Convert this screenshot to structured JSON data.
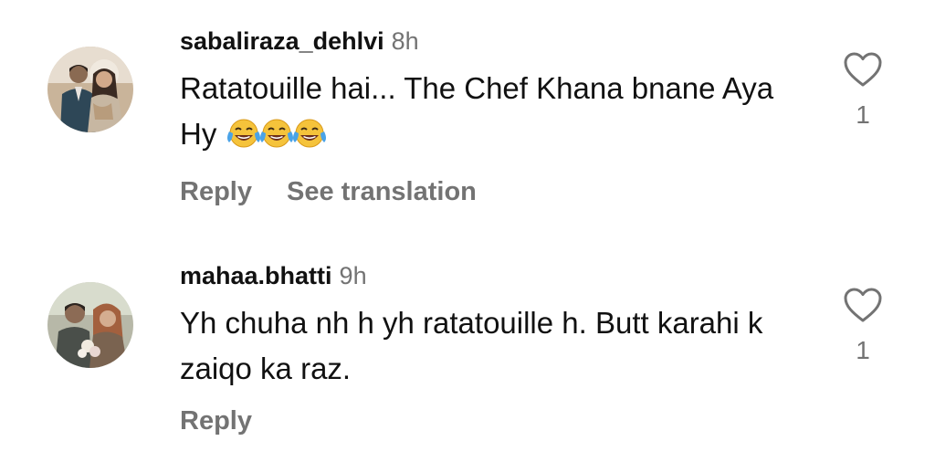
{
  "comments": [
    {
      "username": "sabaliraza_dehlvi",
      "time": "8h",
      "text": "Ratatouille hai... The Chef Khana bnane Aya Hy",
      "emoji": [
        "face-with-tears-of-joy",
        "face-with-tears-of-joy",
        "face-with-tears-of-joy"
      ],
      "actions": {
        "reply": "Reply",
        "translate": "See translation"
      },
      "like_icon": "heart-outline-icon",
      "likes": "1"
    },
    {
      "username": "mahaa.bhatti",
      "time": "9h",
      "text": "Yh chuha nh h yh ratatouille h. Butt karahi k zaiqo ka raz.",
      "actions": {
        "reply": "Reply"
      },
      "like_icon": "heart-outline-icon",
      "likes": "1"
    }
  ],
  "colors": {
    "text_primary": "#111111",
    "text_secondary": "#737373",
    "background": "#ffffff"
  }
}
